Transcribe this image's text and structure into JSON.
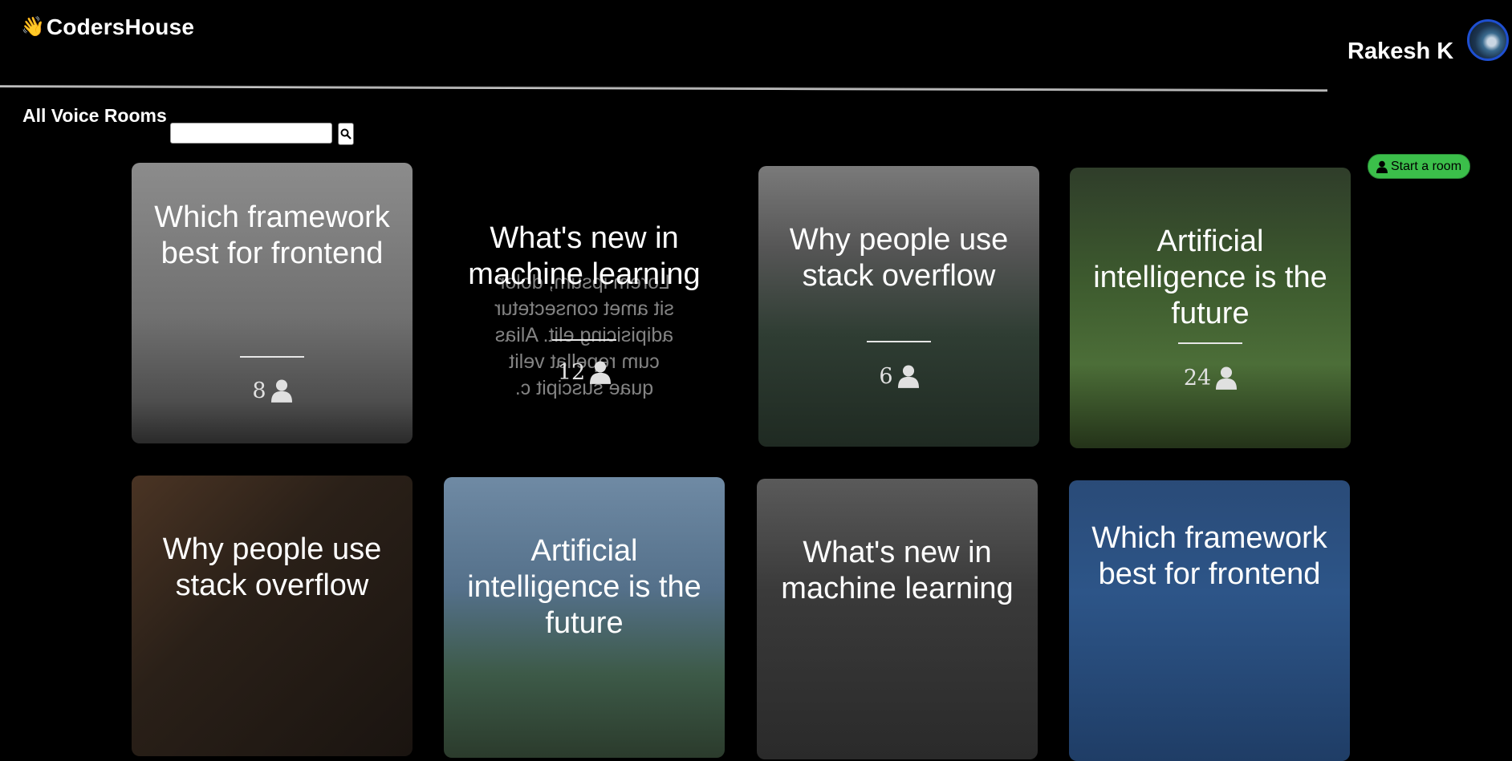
{
  "header": {
    "logo_text": "CodersHouse",
    "logo_icon": "waving-hand-icon",
    "user_name": "Rakesh K"
  },
  "rooms": {
    "title": "All Voice Rooms",
    "search_value": "",
    "start_label": "Start a room"
  },
  "cards": [
    {
      "title": "Which framework best for frontend",
      "count": "8"
    },
    {
      "title": "What's new in machine learning",
      "count": "12",
      "ghost": "Lorem ipsum, dolor sit amet consectetur adipisicing elit. Alias cum repellat velit quae suscipit c."
    },
    {
      "title": "Why people use stack overflow",
      "count": "6"
    },
    {
      "title": "Artificial intelligence is the future",
      "count": "24"
    },
    {
      "title": "Why people use stack overflow",
      "count": ""
    },
    {
      "title": "Artificial intelligence is the future",
      "count": ""
    },
    {
      "title": "What's new in machine learning",
      "count": ""
    },
    {
      "title": "Which framework best for frontend",
      "count": ""
    }
  ],
  "colors": {
    "accent_green": "#3bbf4a",
    "avatar_border": "#1e4fd1"
  }
}
